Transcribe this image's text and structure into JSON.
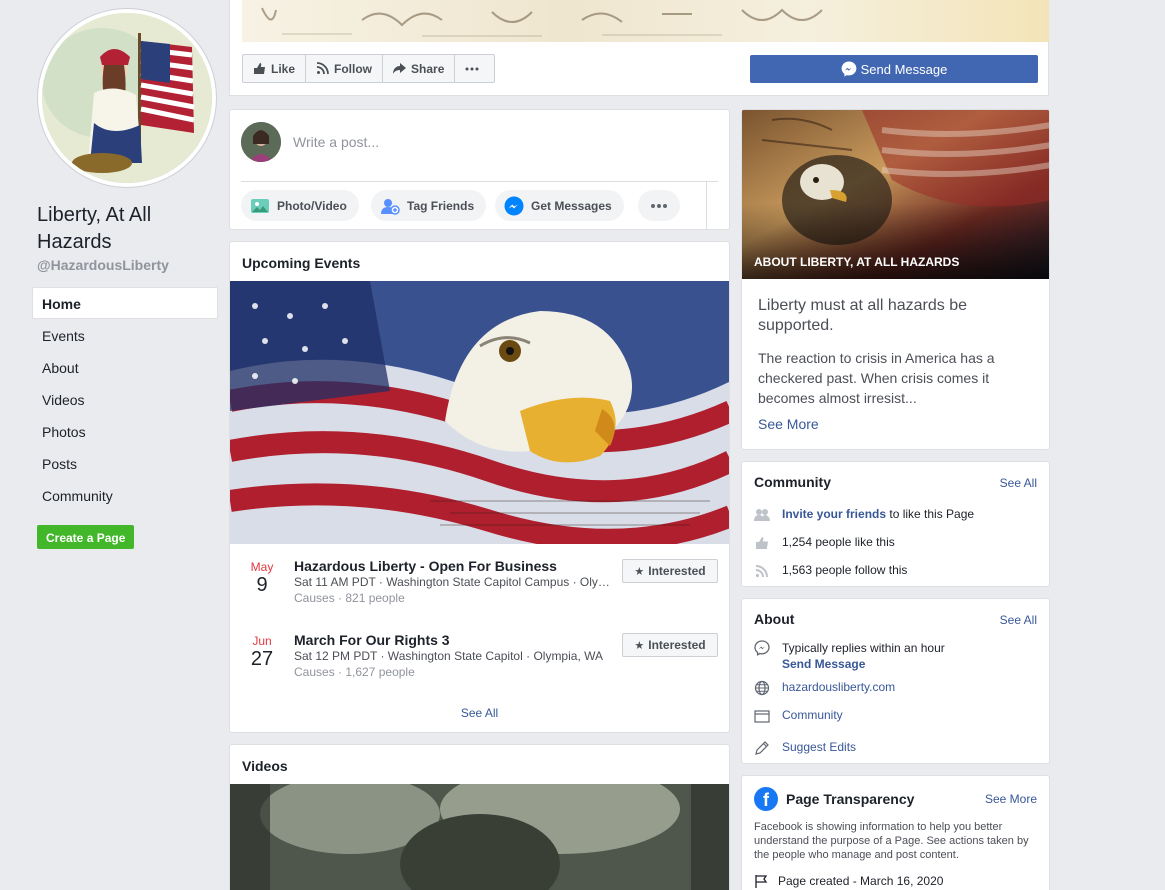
{
  "page": {
    "name": "Liberty, At All Hazards",
    "handle": "@HazardousLiberty"
  },
  "nav": {
    "items": [
      {
        "label": "Home"
      },
      {
        "label": "Events"
      },
      {
        "label": "About"
      },
      {
        "label": "Videos"
      },
      {
        "label": "Photos"
      },
      {
        "label": "Posts"
      },
      {
        "label": "Community"
      }
    ],
    "create_page": "Create a Page"
  },
  "actions": {
    "like": "Like",
    "follow": "Follow",
    "share": "Share",
    "send_message": "Send Message"
  },
  "composer": {
    "placeholder": "Write a post...",
    "photo_video": "Photo/Video",
    "tag_friends": "Tag Friends",
    "get_messages": "Get Messages"
  },
  "events": {
    "title": "Upcoming Events",
    "items": [
      {
        "month": "May",
        "day": "9",
        "title": "Hazardous Liberty - Open For Business",
        "details": "Sat 11 AM PDT · Washington State Capitol Campus · Olympia",
        "meta": "Causes · 821 people",
        "button": "Interested"
      },
      {
        "month": "Jun",
        "day": "27",
        "title": "March For Our Rights 3",
        "details": "Sat 12 PM PDT · Washington State Capitol · Olympia, WA",
        "meta": "Causes · 1,627 people",
        "button": "Interested"
      }
    ],
    "see_all": "See All"
  },
  "videos": {
    "title": "Videos"
  },
  "about_hero": {
    "label": "ABOUT LIBERTY, AT ALL HAZARDS",
    "quote": "Liberty must at all hazards be supported.",
    "body": "The reaction to crisis in America has a checkered past. When crisis comes it becomes almost irresist...",
    "see_more": "See More"
  },
  "community": {
    "title": "Community",
    "see_all": "See All",
    "invite_link": "Invite your friends",
    "invite_rest": " to like this Page",
    "likes": "1,254 people like this",
    "follows": "1,563 people follow this"
  },
  "about": {
    "title": "About",
    "see_all": "See All",
    "replies": "Typically replies within an hour",
    "send_message": "Send Message",
    "website": "hazardousliberty.com",
    "category": "Community",
    "suggest": "Suggest Edits"
  },
  "transparency": {
    "title": "Page Transparency",
    "see_more": "See More",
    "body": "Facebook is showing information to help you better understand the purpose of a Page. See actions taken by the people who manage and post content.",
    "created": "Page created - March 16, 2020"
  },
  "colors": {
    "brand_blue": "#4267b2",
    "link": "#385898",
    "green": "#42b72a",
    "date_red": "#e0393e"
  }
}
